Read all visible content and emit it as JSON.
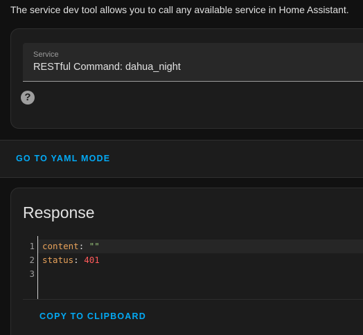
{
  "intro_text": "The service dev tool allows you to call any available service in Home Assistant.",
  "service_field": {
    "label": "Service",
    "value": "RESTful Command: dahua_night"
  },
  "help_icon": {
    "glyph": "?",
    "name": "help-circle-icon"
  },
  "yaml_mode_button": "GO TO YAML MODE",
  "response": {
    "title": "Response",
    "line_numbers": [
      "1",
      "2",
      "3"
    ],
    "lines": [
      {
        "key": "content",
        "sep": ": ",
        "value": "\"\"",
        "value_type": "string"
      },
      {
        "key": "status",
        "sep": ": ",
        "value": "401",
        "value_type": "number"
      },
      {
        "key": "",
        "sep": "",
        "value": "",
        "value_type": "empty"
      }
    ],
    "copy_button": "COPY TO CLIPBOARD"
  },
  "colors": {
    "accent": "#03a9f4",
    "background": "#111111",
    "card": "#1c1c1c",
    "yaml_key": "#e8a25a",
    "yaml_string": "#98c379",
    "yaml_number": "#ff5a5a"
  }
}
